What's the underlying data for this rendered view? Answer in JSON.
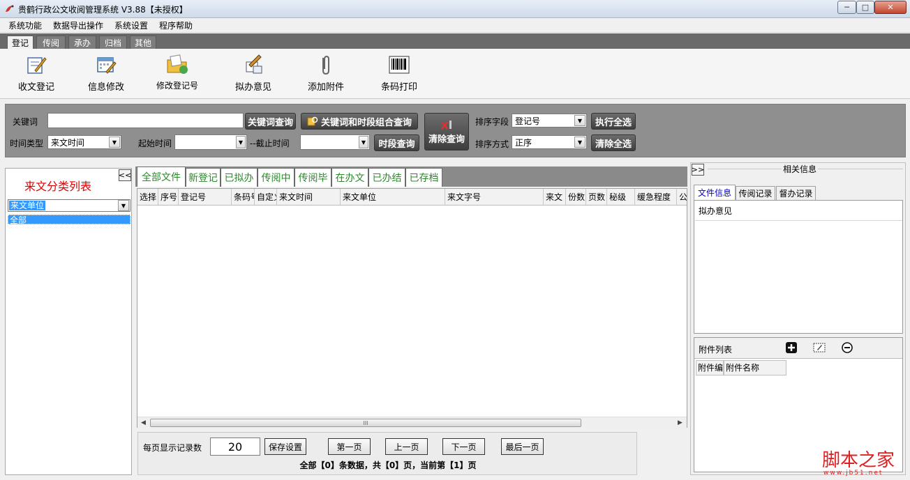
{
  "window": {
    "title": "贵鹤行政公文收阅管理系统 V3.88【未授权】",
    "minimize_glyph": "─",
    "maximize_glyph": "□",
    "close_glyph": "✕"
  },
  "menu": [
    "系统功能",
    "数据导出操作",
    "系统设置",
    "程序帮助"
  ],
  "module_tabs": [
    "登记",
    "传阅",
    "承办",
    "归档",
    "其他"
  ],
  "toolbar": [
    {
      "label": "收文登记",
      "icon": "register-edit-icon"
    },
    {
      "label": "信息修改",
      "icon": "calendar-edit-icon"
    },
    {
      "label": "修改登记号",
      "icon": "folder-edit-icon"
    },
    {
      "label": "拟办意见",
      "icon": "document-pen-icon"
    },
    {
      "label": "添加附件",
      "icon": "paperclip-icon"
    },
    {
      "label": "条码打印",
      "icon": "barcode-icon"
    }
  ],
  "search": {
    "keyword_label": "关键词",
    "keyword_value": "",
    "keyword_btn": "关键词查询",
    "combo_btn": "关键词和时段组合查询",
    "clear_btn": "清除查询",
    "sort_field_label": "排序字段",
    "sort_field_value": "登记号",
    "run_select_btn": "执行全选",
    "time_type_label": "时间类型",
    "time_type_value": "来文时间",
    "start_label": "起始时间",
    "end_label": "--截止时间",
    "period_btn": "时段查询",
    "sort_order_label": "排序方式",
    "sort_order_value": "正序",
    "clear_select_btn": "清除全选"
  },
  "left_panel": {
    "title": "来文分类列表",
    "collapse_glyph": "<<",
    "category_value": "来文单位",
    "list_items": [
      "全部"
    ]
  },
  "center_tabs": [
    "全部文件",
    "新登记",
    "已拟办",
    "传阅中",
    "传阅毕",
    "在办文",
    "已办结",
    "已存档"
  ],
  "grid_columns": [
    "选择",
    "序号",
    "登记号",
    "条码号",
    "自定义",
    "来文时间",
    "来文单位",
    "来文字号",
    "来文",
    "份数",
    "页数",
    "秘级",
    "缓急程度",
    "公"
  ],
  "hscroll_glyphs": {
    "left": "◀",
    "right": "▶",
    "grip": "III"
  },
  "pager": {
    "page_size_label": "每页显示记录数",
    "page_size_value": "20",
    "save_btn": "保存设置",
    "first_btn": "第一页",
    "prev_btn": "上一页",
    "next_btn": "下一页",
    "last_btn": "最后一页",
    "summary": "全部【0】条数据，共【0】页，当前第【1】页"
  },
  "right_panel": {
    "title": "相关信息",
    "expand_glyph": ">>",
    "tabs": [
      "文件信息",
      "传阅记录",
      "督办记录"
    ],
    "opinion_label": "拟办意见",
    "attach_label": "附件列表",
    "attach_columns": [
      "附件编号",
      "附件名称"
    ]
  },
  "watermark": {
    "main": "脚本之家",
    "sub": "www.jb51.net"
  },
  "colors": {
    "accent_red": "#e00000",
    "tab_green": "#2a8a2a",
    "selection_blue": "#3399ff",
    "dark_button": "#4a4a4a"
  }
}
